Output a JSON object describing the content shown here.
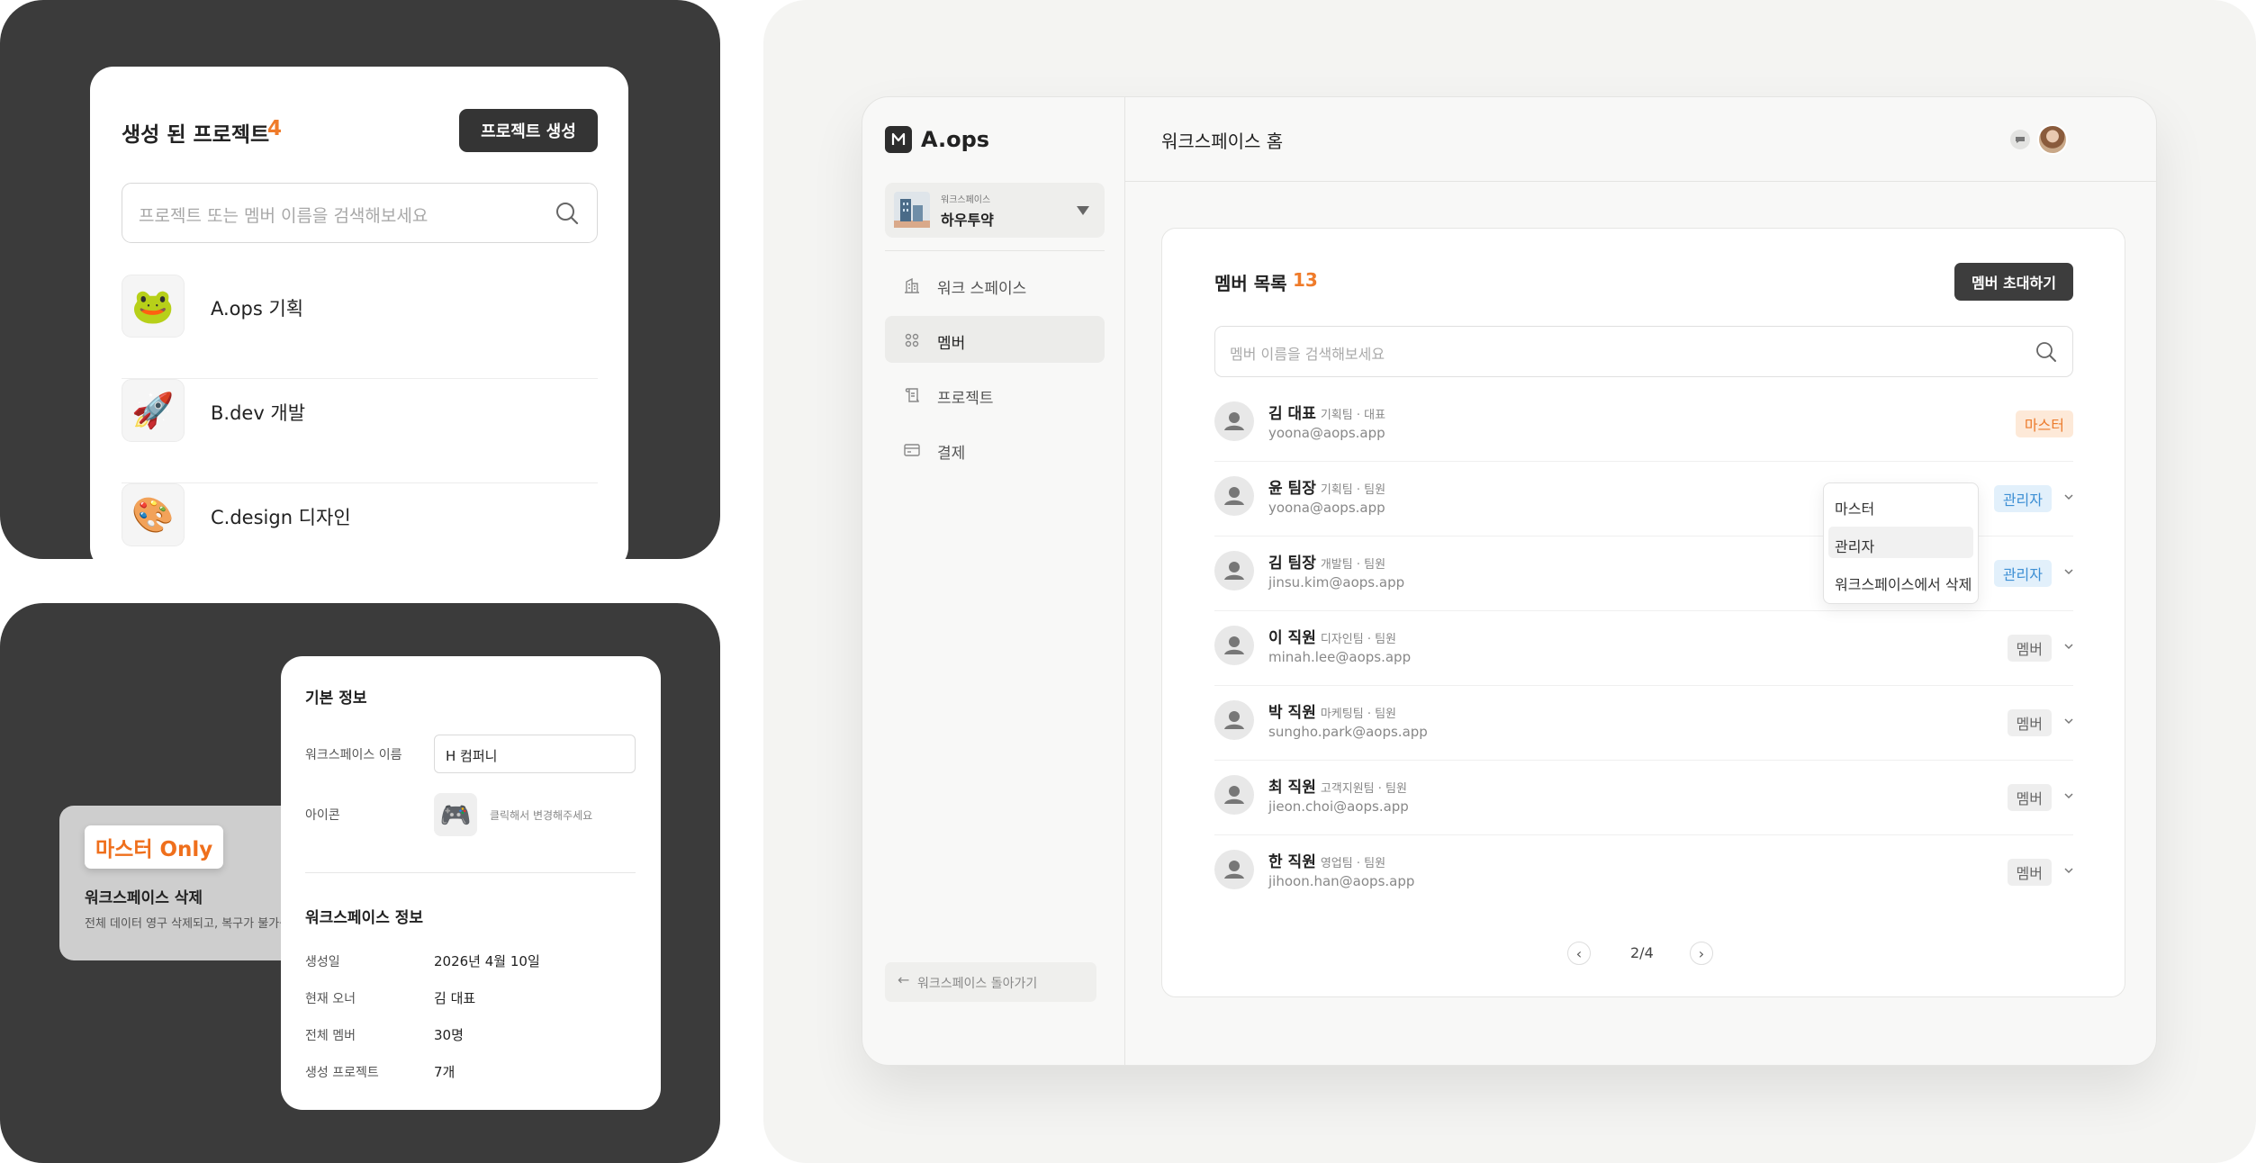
{
  "projects_card": {
    "title": "생성 된 프로젝트",
    "count": "4",
    "create_button": "프로젝트 생성",
    "search_placeholder": "프로젝트 또는 멤버 이름을 검색해보세요",
    "projects": [
      {
        "icon": "frog-emoji",
        "glyph": "🐸",
        "name": "A.ops 기획"
      },
      {
        "icon": "rocket-emoji",
        "glyph": "🚀",
        "name": "B.dev 개발"
      },
      {
        "icon": "palette-emoji",
        "glyph": "🎨",
        "name": "C.design 디자인"
      }
    ]
  },
  "master_card": {
    "badge": "마스터 Only",
    "title": "워크스페이스 삭제",
    "description": "전체 데이터 영구 삭제되고, 복구가 불가능"
  },
  "info_card": {
    "basic_section": "기본 정보",
    "name_label": "워크스페이스 이름",
    "name_value": "H 컴퍼니",
    "icon_label": "아이콘",
    "icon_glyph": "🎮",
    "icon_hint": "클릭해서 변경해주세요",
    "ws_section": "워크스페이스 정보",
    "details": [
      {
        "label": "생성일",
        "value": "2026년 4월 10일"
      },
      {
        "label": "현재 오너",
        "value": "김 대표"
      },
      {
        "label": "전체 멤버",
        "value": "30명"
      },
      {
        "label": "생성 프로젝트",
        "value": "7개"
      }
    ]
  },
  "app": {
    "brand": "A.ops",
    "workspace": {
      "caption": "워크스페이스",
      "name": "하우투약"
    },
    "nav": [
      {
        "label": "워크 스페이스",
        "icon": "building-icon",
        "active": false
      },
      {
        "label": "멤버",
        "icon": "members-icon",
        "active": true
      },
      {
        "label": "프로젝트",
        "icon": "scroll-icon",
        "active": false
      },
      {
        "label": "결제",
        "icon": "card-icon",
        "active": false
      }
    ],
    "back_link": "워크스페이스 돌아가기",
    "page_title": "워크스페이스 홈"
  },
  "members": {
    "title": "멤버 목록",
    "count": "13",
    "invite_button": "멤버 초대하기",
    "search_placeholder": "멤버 이름을 검색해보세요",
    "rows": [
      {
        "name": "김 대표",
        "team": "기획팀 · 대표",
        "email": "yoona@aops.app",
        "role": "마스터",
        "role_type": "master"
      },
      {
        "name": "윤 팀장",
        "team": "기획팀 · 팀원",
        "email": "yoona@aops.app",
        "role": "관리자",
        "role_type": "admin"
      },
      {
        "name": "김 팀장",
        "team": "개발팀 · 팀원",
        "email": "jinsu.kim@aops.app",
        "role": "관리자",
        "role_type": "admin"
      },
      {
        "name": "이 직원",
        "team": "디자인팀 · 팀원",
        "email": "minah.lee@aops.app",
        "role": "멤버",
        "role_type": "member"
      },
      {
        "name": "박 직원",
        "team": "마케팅팀 · 팀원",
        "email": "sungho.park@aops.app",
        "role": "멤버",
        "role_type": "member"
      },
      {
        "name": "최 직원",
        "team": "고객지원팀 · 팀원",
        "email": "jieon.choi@aops.app",
        "role": "멤버",
        "role_type": "member"
      },
      {
        "name": "한 직원",
        "team": "영업팀 · 팀원",
        "email": "jihoon.han@aops.app",
        "role": "멤버",
        "role_type": "member"
      }
    ],
    "pagination": "2/4",
    "role_menu": [
      "마스터",
      "관리자",
      "워크스페이스에서 삭제"
    ],
    "role_menu_selected": "관리자"
  },
  "colors": {
    "accent": "#ef7b2a",
    "dark": "#3b3b3b",
    "admin": "#3d8fd4"
  }
}
